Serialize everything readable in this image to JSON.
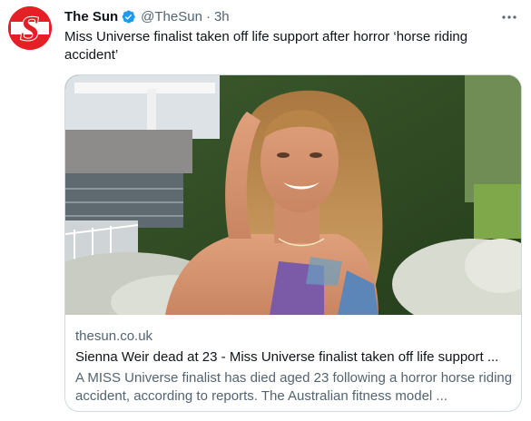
{
  "tweet": {
    "display_name": "The Sun",
    "handle": "@TheSun",
    "separator": "·",
    "time": "3h",
    "text": "Miss Universe finalist taken off life support after horror ‘horse riding accident’",
    "avatar_logo": "S"
  },
  "card": {
    "domain": "thesun.co.uk",
    "title": "Sienna Weir dead at 23 - Miss Universe finalist taken off life support ...",
    "description": "A MISS Universe finalist has died aged 23 following a horror horse riding accident, according to reports. The Australian fitness model ..."
  },
  "icons": {
    "verified": "verified-badge-icon",
    "more": "more-options-icon"
  },
  "colors": {
    "brand_red": "#e41f25",
    "verified_blue": "#1d9bf0",
    "secondary_text": "#536471",
    "border": "#cfd9de"
  }
}
